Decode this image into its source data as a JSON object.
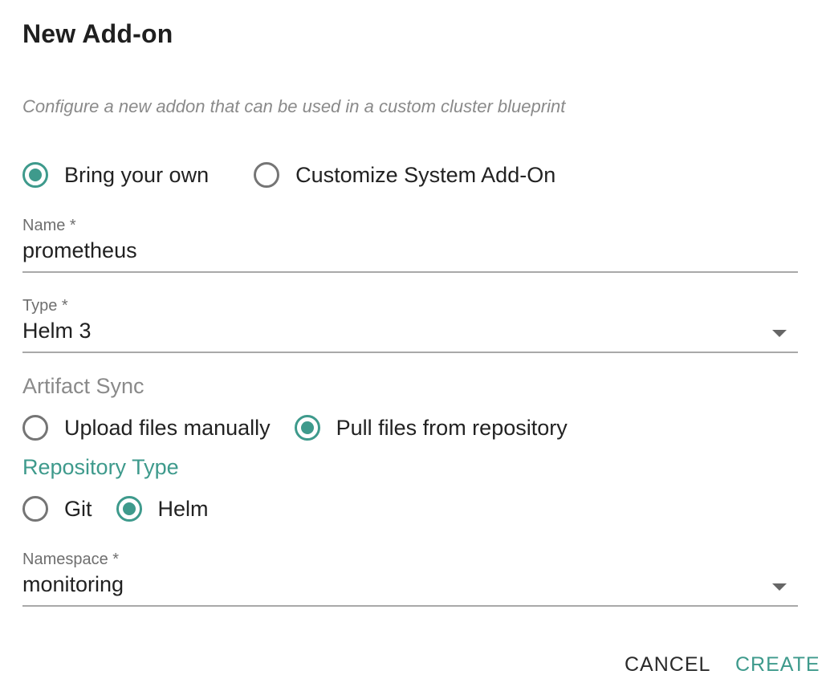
{
  "dialog": {
    "title": "New Add-on",
    "subtitle": "Configure a new addon that can be used in a custom cluster blueprint"
  },
  "source": {
    "options": [
      {
        "label": "Bring your own",
        "checked": true
      },
      {
        "label": "Customize System Add-On",
        "checked": false
      }
    ]
  },
  "name_field": {
    "label": "Name *",
    "value": "prometheus"
  },
  "type_field": {
    "label": "Type *",
    "value": "Helm 3"
  },
  "artifact_sync": {
    "label": "Artifact Sync",
    "options": [
      {
        "label": "Upload files manually",
        "checked": false
      },
      {
        "label": "Pull files from repository",
        "checked": true
      }
    ]
  },
  "repository_type": {
    "label": "Repository Type",
    "options": [
      {
        "label": "Git",
        "checked": false
      },
      {
        "label": "Helm",
        "checked": true
      }
    ]
  },
  "namespace_field": {
    "label": "Namespace *",
    "value": "monitoring"
  },
  "actions": {
    "cancel": "CANCEL",
    "create": "CREATE"
  },
  "colors": {
    "accent": "#3e9a8c",
    "radio_unchecked": "#757575",
    "underline": "#a9a9a9"
  }
}
